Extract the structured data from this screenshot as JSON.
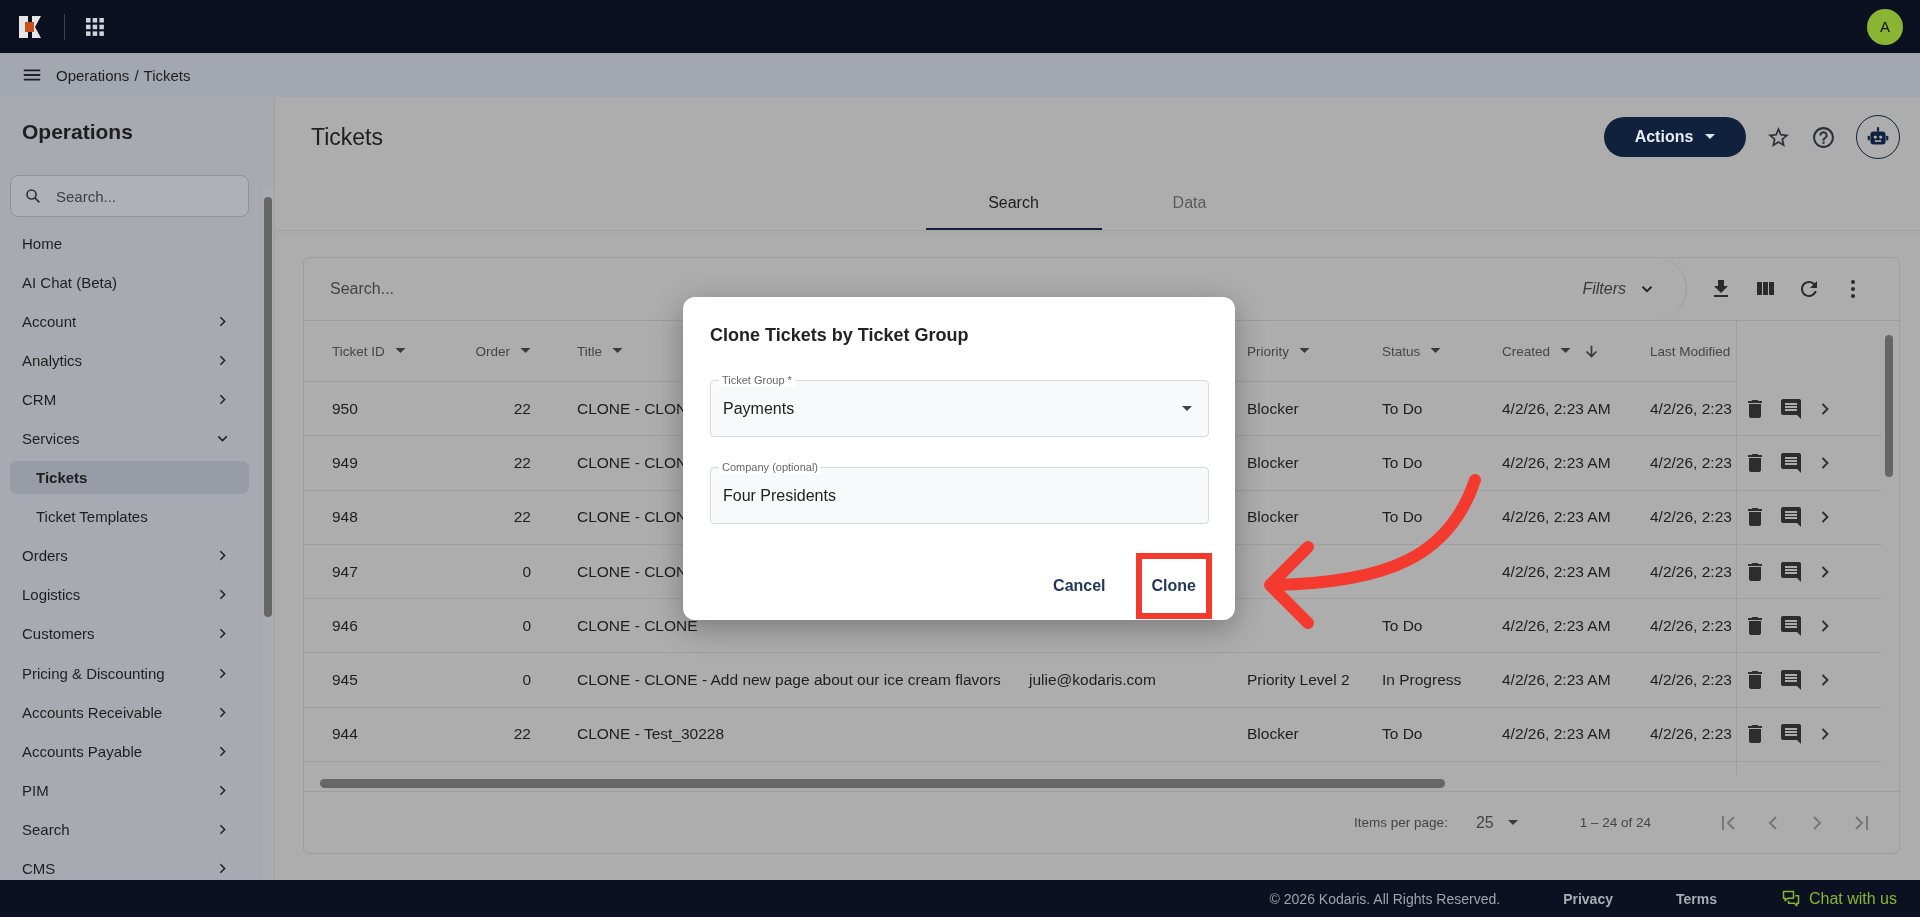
{
  "topbar": {
    "avatar": "A"
  },
  "breadcrumb": {
    "items": [
      "Operations",
      "Tickets"
    ],
    "separator": "/"
  },
  "sidebar": {
    "title": "Operations",
    "search_placeholder": "Search...",
    "items": [
      {
        "label": "Home",
        "kind": "link",
        "selected": false
      },
      {
        "label": "AI Chat (Beta)",
        "kind": "link",
        "selected": false
      },
      {
        "label": "Account",
        "kind": "group",
        "expanded": false,
        "selected": false
      },
      {
        "label": "Analytics",
        "kind": "group",
        "expanded": false,
        "selected": false
      },
      {
        "label": "CRM",
        "kind": "group",
        "expanded": false,
        "selected": false
      },
      {
        "label": "Services",
        "kind": "group",
        "expanded": true,
        "selected": false,
        "children": [
          {
            "label": "Tickets",
            "selected": true
          },
          {
            "label": "Ticket Templates",
            "selected": false
          }
        ]
      },
      {
        "label": "Orders",
        "kind": "group",
        "expanded": false,
        "selected": false
      },
      {
        "label": "Logistics",
        "kind": "group",
        "expanded": false,
        "selected": false
      },
      {
        "label": "Customers",
        "kind": "group",
        "expanded": false,
        "selected": false
      },
      {
        "label": "Pricing & Discounting",
        "kind": "group",
        "expanded": false,
        "selected": false
      },
      {
        "label": "Accounts Receivable",
        "kind": "group",
        "expanded": false,
        "selected": false
      },
      {
        "label": "Accounts Payable",
        "kind": "group",
        "expanded": false,
        "selected": false
      },
      {
        "label": "PIM",
        "kind": "group",
        "expanded": false,
        "selected": false
      },
      {
        "label": "Search",
        "kind": "group",
        "expanded": false,
        "selected": false
      },
      {
        "label": "CMS",
        "kind": "group",
        "expanded": false,
        "selected": false
      }
    ]
  },
  "page": {
    "title": "Tickets",
    "actions_button": "Actions"
  },
  "tabs": [
    {
      "label": "Search",
      "selected": true
    },
    {
      "label": "Data",
      "selected": false
    }
  ],
  "table": {
    "search_placeholder": "Search...",
    "filters_label": "Filters",
    "columns": [
      {
        "label": "Ticket ID",
        "menu": true,
        "sorted": false
      },
      {
        "label": "Order",
        "menu": true,
        "sorted": false
      },
      {
        "label": "Title",
        "menu": true,
        "sorted": false
      },
      {},
      {
        "label": "Priority",
        "menu": true,
        "sorted": false
      },
      {
        "label": "Status",
        "menu": true,
        "sorted": false
      },
      {
        "label": "Created",
        "menu": true,
        "sorted": true
      },
      {
        "label": "Last Modified"
      }
    ],
    "rows": [
      {
        "cells": [
          "950",
          "22",
          "CLONE - CLON",
          null,
          "Blocker",
          "To Do",
          "4/2/26, 2:23 AM",
          "4/2/26, 2:23"
        ]
      },
      {
        "cells": [
          "949",
          "22",
          "CLONE - CLON",
          null,
          "Blocker",
          "To Do",
          "4/2/26, 2:23 AM",
          "4/2/26, 2:23"
        ]
      },
      {
        "cells": [
          "948",
          "22",
          "CLONE - CLON",
          null,
          "Blocker",
          "To Do",
          "4/2/26, 2:23 AM",
          "4/2/26, 2:23"
        ]
      },
      {
        "cells": [
          "947",
          "0",
          "CLONE - CLON",
          null,
          null,
          null,
          "4/2/26, 2:23 AM",
          "4/2/26, 2:23"
        ]
      },
      {
        "cells": [
          "946",
          "0",
          "CLONE - CLONE",
          null,
          null,
          "To Do",
          "4/2/26, 2:23 AM",
          "4/2/26, 2:23"
        ]
      },
      {
        "cells": [
          "945",
          "0",
          "CLONE - CLONE - Add new page about our ice cream flavors",
          "julie@kodaris.com",
          "Priority Level 2",
          "In Progress",
          "4/2/26, 2:23 AM",
          "4/2/26, 2:23"
        ]
      },
      {
        "cells": [
          "944",
          "22",
          "CLONE - Test_30228",
          null,
          "Blocker",
          "To Do",
          "4/2/26, 2:23 AM",
          "4/2/26, 2:23"
        ]
      }
    ],
    "pagination": {
      "items_per_page_label": "Items per page:",
      "page_size": "25",
      "range": "1 – 24 of 24"
    }
  },
  "dialog": {
    "title": "Clone Tickets by Ticket Group",
    "fields": [
      {
        "kind": "select",
        "label": "Ticket Group *",
        "value": "Payments"
      },
      {
        "kind": "text",
        "label": "Company (optional)",
        "value": "Four Presidents"
      }
    ],
    "buttons": [
      {
        "label": "Cancel",
        "highlighted": false
      },
      {
        "label": "Clone",
        "highlighted": true
      }
    ]
  },
  "footer": {
    "copyright": "© 2026 Kodaris. All Rights Reserved.",
    "links": [
      "Privacy",
      "Terms"
    ],
    "chat": "Chat with us"
  }
}
